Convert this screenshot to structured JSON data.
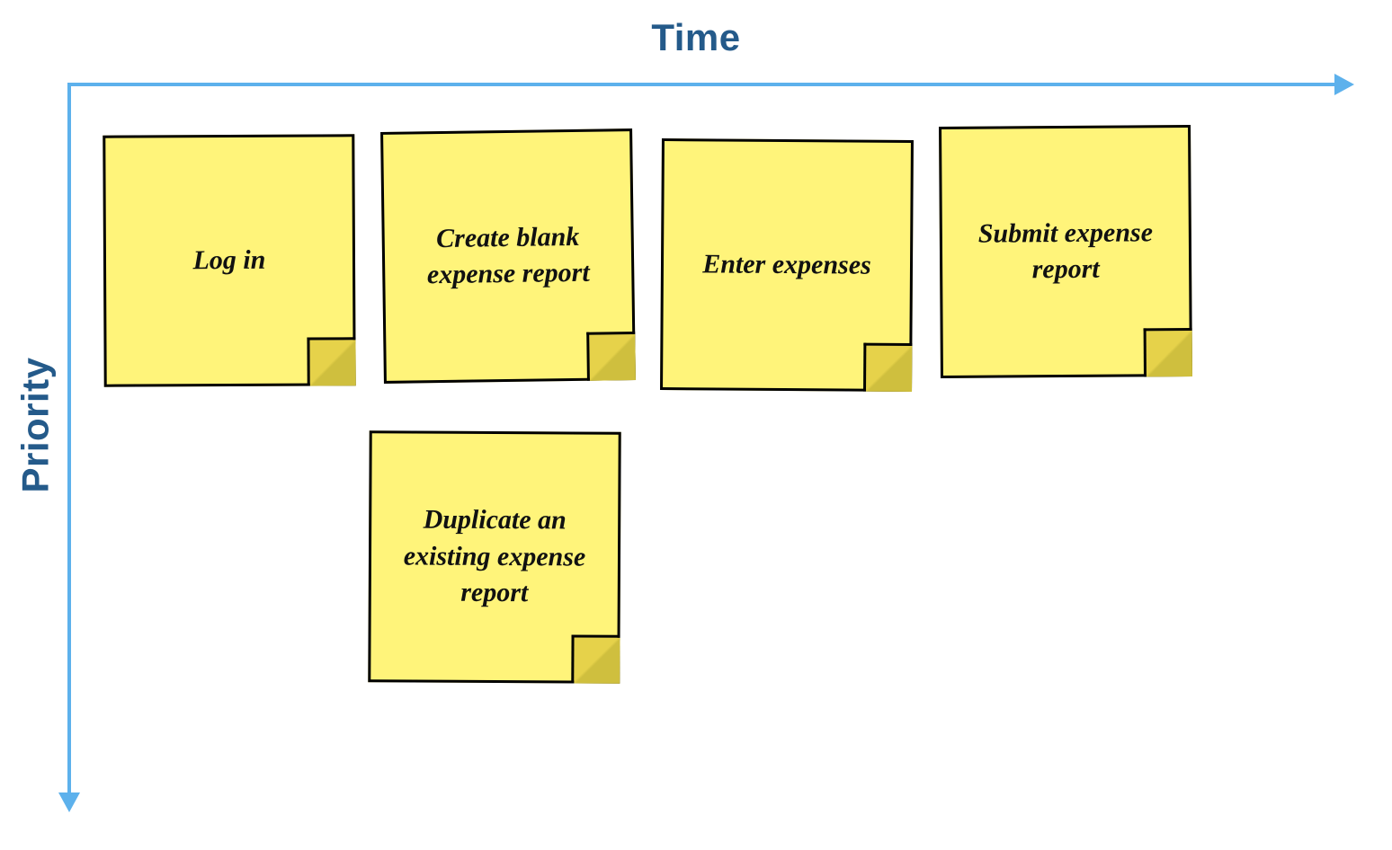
{
  "axes": {
    "horizontal_label": "Time",
    "vertical_label": "Priority",
    "color_line": "#5db1ec",
    "color_text": "#245a8a"
  },
  "notes": [
    {
      "id": "note-login",
      "label": "Log in",
      "row": 0,
      "col": 0
    },
    {
      "id": "note-create-blank",
      "label": "Create blank expense report",
      "row": 0,
      "col": 1
    },
    {
      "id": "note-enter-expenses",
      "label": "Enter expenses",
      "row": 0,
      "col": 2
    },
    {
      "id": "note-submit",
      "label": "Submit expense report",
      "row": 0,
      "col": 3
    },
    {
      "id": "note-duplicate",
      "label": "Duplicate an existing expense report",
      "row": 1,
      "col": 1
    }
  ],
  "sticky_color": "#fff47a"
}
